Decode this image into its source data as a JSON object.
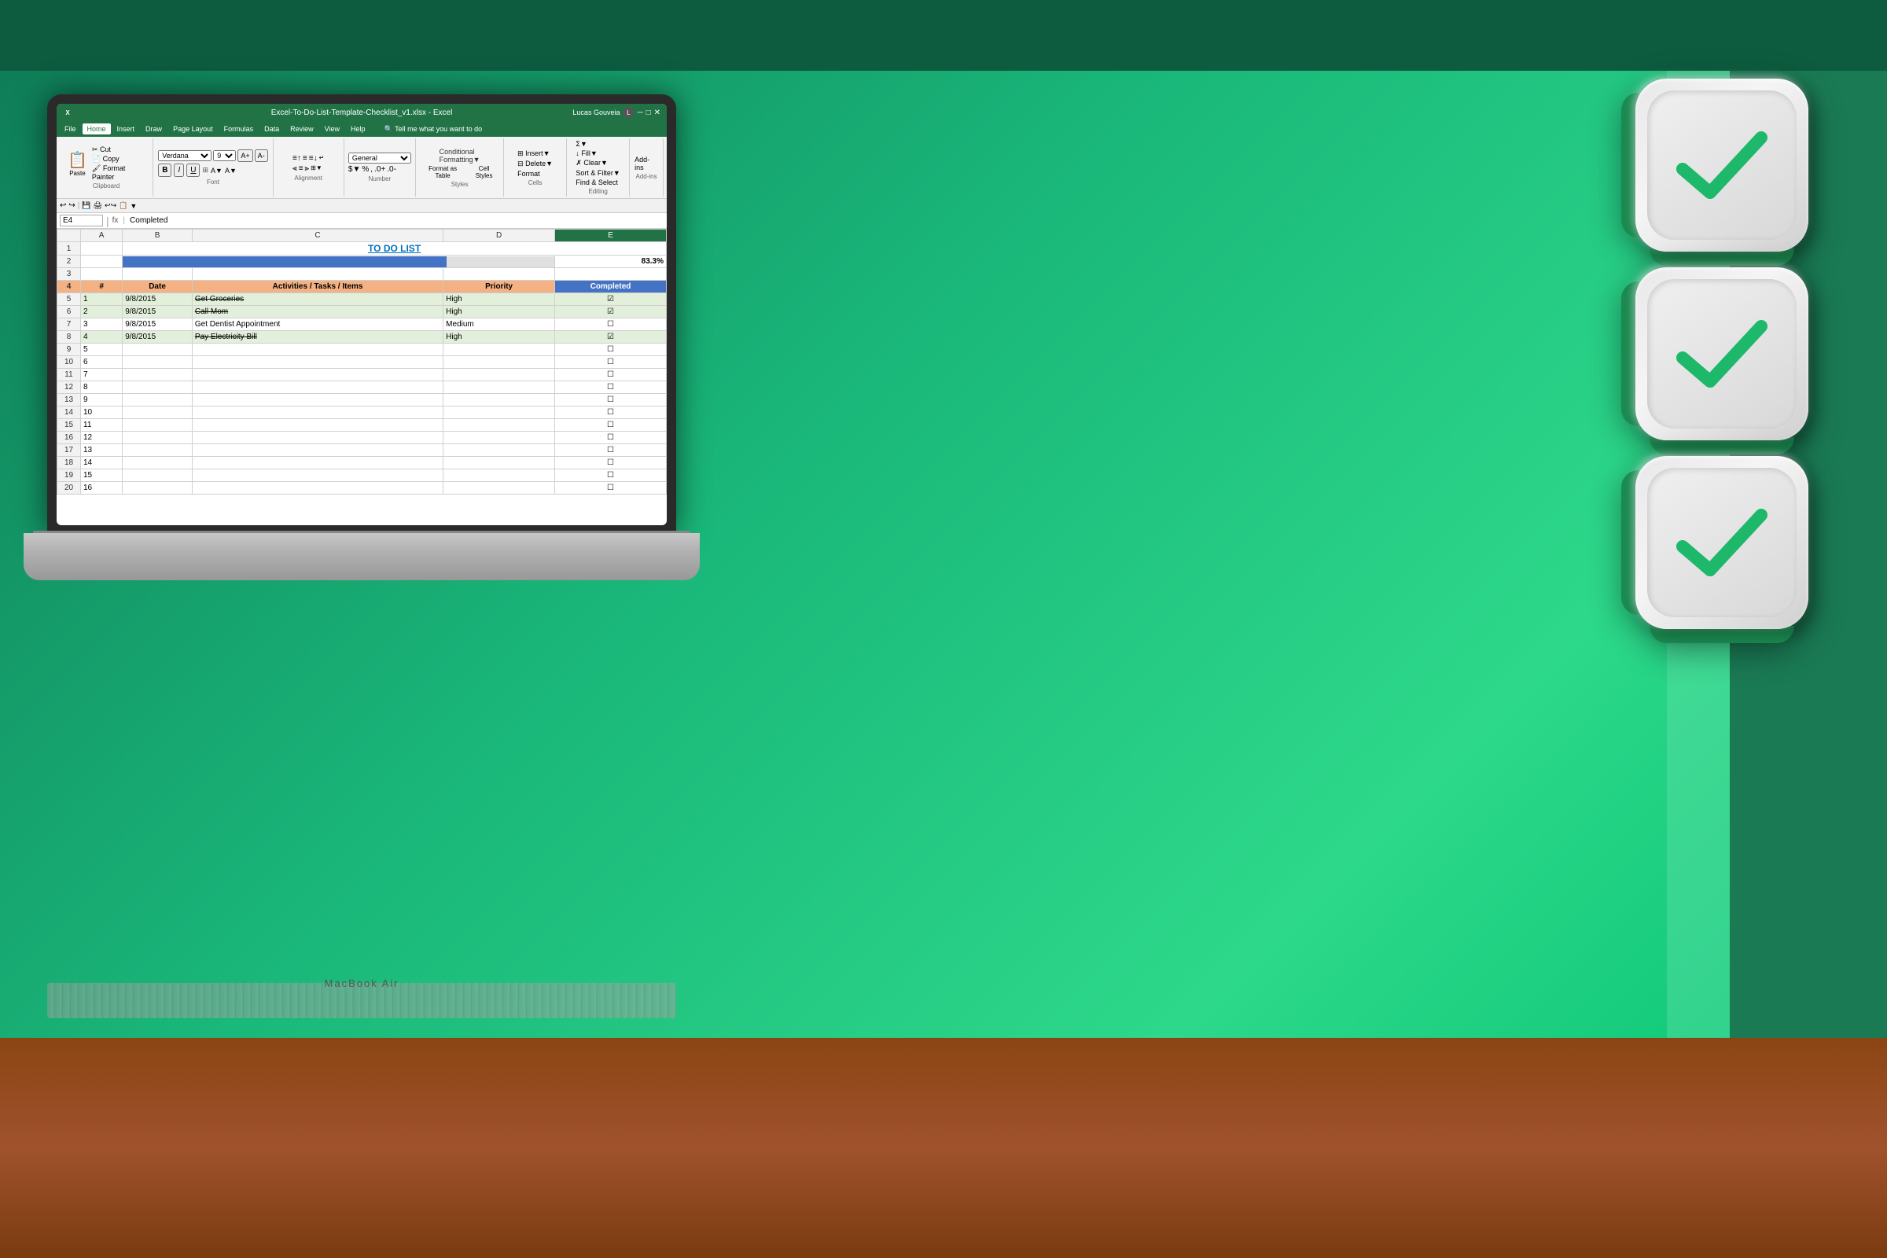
{
  "background": {
    "main_color": "#1a9a6c",
    "top_bar_color": "#0d5c40",
    "right_color": "#1a7a54"
  },
  "laptop": {
    "brand": "MacBook Air"
  },
  "excel": {
    "title": "Excel-To-Do-List-Template-Checklist_v1.xlsx - Excel",
    "user": "Lucas Gouveia",
    "menu_items": [
      "File",
      "Home",
      "Insert",
      "Draw",
      "Page Layout",
      "Formulas",
      "Data",
      "Review",
      "View",
      "Help",
      "Tell me what you want to do"
    ],
    "active_tab": "Home",
    "cell_ref": "E4",
    "formula": "Completed",
    "spreadsheet_title": "TO DO LIST",
    "progress_pct": "83.3%",
    "columns": [
      "#",
      "B",
      "C",
      "D",
      "E"
    ],
    "col_headers": [
      "",
      "A",
      "B",
      "C",
      "D",
      "E"
    ],
    "table_headers": [
      "#",
      "Date",
      "Activities / Tasks / Items",
      "Priority",
      "Completed"
    ],
    "tasks": [
      {
        "num": "1",
        "date": "9/8/2015",
        "task": "Get Groceries",
        "priority": "High",
        "done": true,
        "strikethrough": true
      },
      {
        "num": "2",
        "date": "9/8/2015",
        "task": "Call Mom",
        "priority": "High",
        "done": true,
        "strikethrough": true
      },
      {
        "num": "3",
        "date": "9/8/2015",
        "task": "Get Dentist Appointment",
        "priority": "Medium",
        "done": false,
        "strikethrough": false
      },
      {
        "num": "4",
        "date": "9/8/2015",
        "task": "Pay Electricity Bill",
        "priority": "High",
        "done": true,
        "strikethrough": true
      },
      {
        "num": "5",
        "date": "",
        "task": "",
        "priority": "",
        "done": false,
        "strikethrough": false
      },
      {
        "num": "6",
        "date": "",
        "task": "",
        "priority": "",
        "done": false,
        "strikethrough": false
      },
      {
        "num": "7",
        "date": "",
        "task": "",
        "priority": "",
        "done": false,
        "strikethrough": false
      },
      {
        "num": "8",
        "date": "",
        "task": "",
        "priority": "",
        "done": false,
        "strikethrough": false
      },
      {
        "num": "9",
        "date": "",
        "task": "",
        "priority": "",
        "done": false,
        "strikethrough": false
      },
      {
        "num": "10",
        "date": "",
        "task": "",
        "priority": "",
        "done": false,
        "strikethrough": false
      },
      {
        "num": "11",
        "date": "",
        "task": "",
        "priority": "",
        "done": false,
        "strikethrough": false
      },
      {
        "num": "12",
        "date": "",
        "task": "",
        "priority": "",
        "done": false,
        "strikethrough": false
      },
      {
        "num": "13",
        "date": "",
        "task": "",
        "priority": "",
        "done": false,
        "strikethrough": false
      },
      {
        "num": "14",
        "date": "",
        "task": "",
        "priority": "",
        "done": false,
        "strikethrough": false
      },
      {
        "num": "15",
        "date": "",
        "task": "",
        "priority": "",
        "done": false,
        "strikethrough": false
      },
      {
        "num": "16",
        "date": "",
        "task": "",
        "priority": "",
        "done": false,
        "strikethrough": false
      }
    ],
    "ribbon": {
      "clipboard_label": "Clipboard",
      "font_label": "Font",
      "alignment_label": "Alignment",
      "number_label": "Number",
      "styles_label": "Styles",
      "cells_label": "Cells",
      "editing_label": "Editing",
      "paste_label": "Paste",
      "format_as_table_label": "Format as Table",
      "cell_styles_label": "Cell Styles",
      "conditional_format_label": "Conditional Formatting",
      "format_label": "Format",
      "find_select_label": "Find & Select"
    }
  },
  "checkmarks": {
    "count": 3,
    "color": "#1db86a",
    "shadow_color": "rgba(0,0,0,0.4)"
  }
}
